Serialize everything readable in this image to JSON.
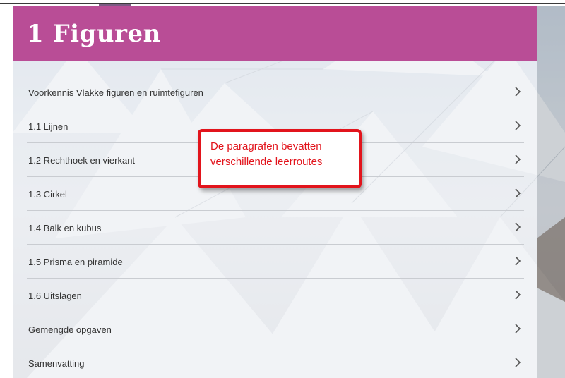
{
  "header": {
    "title": "1 Figuren",
    "color": "#b94d96"
  },
  "menu": {
    "items": [
      {
        "label": "Voorkennis Vlakke figuren en ruimtefiguren",
        "icon": "chevron-right-icon"
      },
      {
        "label": "1.1 Lijnen",
        "icon": "chevron-right-icon"
      },
      {
        "label": "1.2 Rechthoek en vierkant",
        "icon": "chevron-right-icon"
      },
      {
        "label": "1.3 Cirkel",
        "icon": "chevron-right-icon"
      },
      {
        "label": "1.4 Balk en kubus",
        "icon": "chevron-right-icon"
      },
      {
        "label": "1.5 Prisma en piramide",
        "icon": "chevron-right-icon"
      },
      {
        "label": "1.6 Uitslagen",
        "icon": "chevron-right-icon"
      },
      {
        "label": "Gemengde opgaven",
        "icon": "chevron-right-icon"
      },
      {
        "label": "Samenvatting",
        "icon": "chevron-right-icon"
      }
    ]
  },
  "callout": {
    "line1": "De paragrafen bevatten",
    "line2": "verschillende leerroutes",
    "color": "#e2141c"
  }
}
